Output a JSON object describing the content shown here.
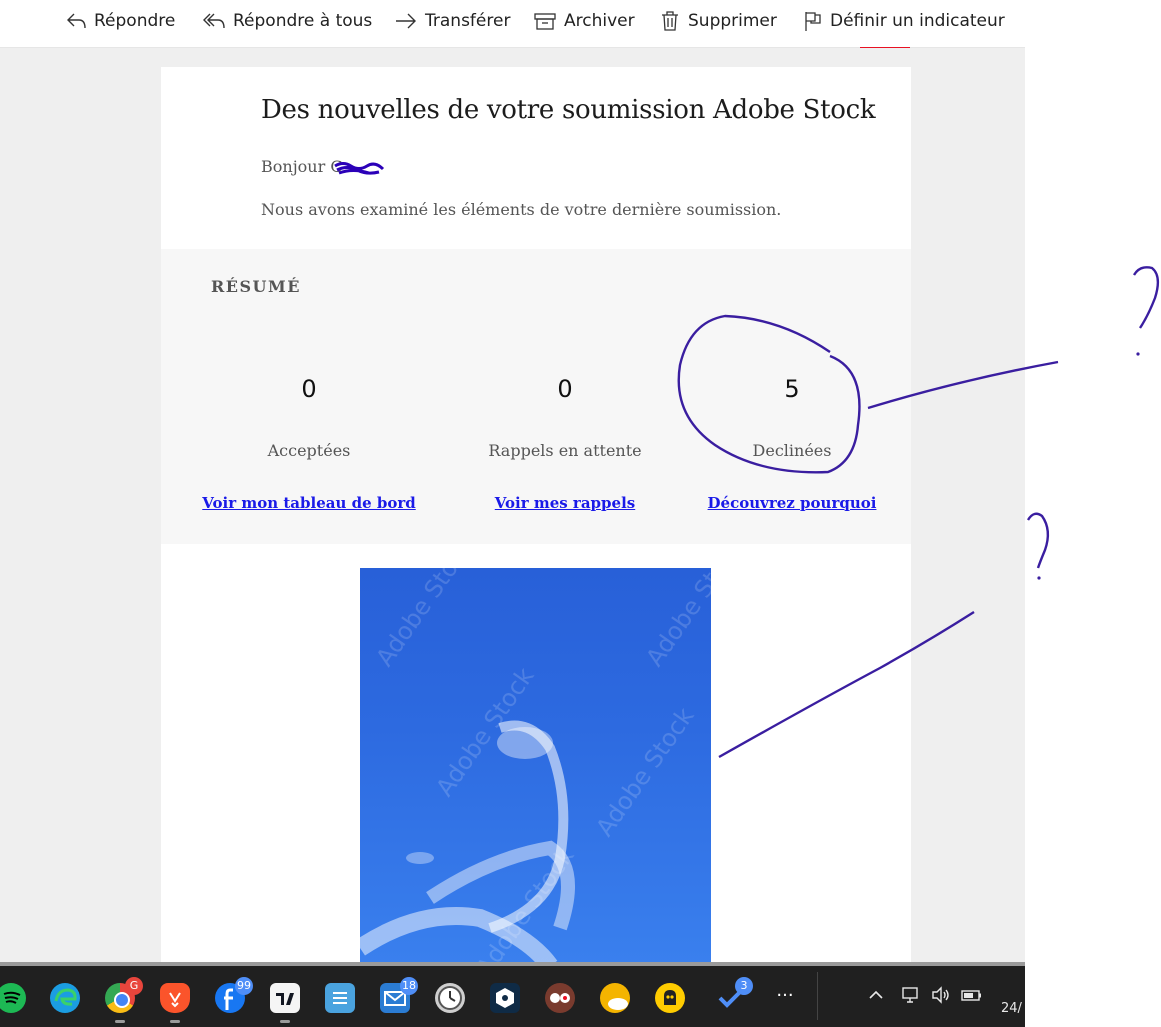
{
  "toolbar": {
    "reply": "Répondre",
    "reply_all": "Répondre à tous",
    "forward": "Transférer",
    "archive": "Archiver",
    "delete": "Supprimer",
    "flag": "Définir un indicateur",
    "accent_color": "#e81123"
  },
  "email": {
    "title": "Des nouvelles de votre soumission Adobe Stock",
    "greeting": "Bonjour C",
    "intro": "Nous avons examiné les éléments de votre dernière soumission.",
    "summary": {
      "heading": "RÉSUMÉ",
      "stats": [
        {
          "value": "0",
          "label": "Acceptées",
          "link": "Voir mon tableau de bord"
        },
        {
          "value": "0",
          "label": "Rappels en attente",
          "link": "Voir mes rappels"
        },
        {
          "value": "5",
          "label": "Declinées",
          "link": "Découvrez pourquoi"
        }
      ]
    },
    "image": {
      "description_icon": "sky-with-clouds-photo",
      "watermark": "Adobe Stock"
    }
  },
  "annotations": {
    "color": "#3a1ea0",
    "question_mark": "?"
  },
  "taskbar": {
    "apps": [
      {
        "name": "spotify-icon",
        "color": "#1db954"
      },
      {
        "name": "edge-icon",
        "color": "#1b9de2"
      },
      {
        "name": "chrome-icon",
        "color": "#e8453c",
        "badge": "G"
      },
      {
        "name": "brave-icon",
        "color": "#fb542b"
      },
      {
        "name": "facebook-icon",
        "color": "#1877f2",
        "badge": "99"
      },
      {
        "name": "tradingview-icon",
        "color": "#131722"
      },
      {
        "name": "notepad-icon",
        "color": "#4aa3df"
      },
      {
        "name": "mail-icon",
        "color": "#2b7cd3",
        "badge": "18"
      },
      {
        "name": "clock-icon",
        "color": "#cfcfcf"
      },
      {
        "name": "deepl-icon",
        "color": "#0f2b46"
      },
      {
        "name": "video-player-icon",
        "color": "#7a3b2e"
      },
      {
        "name": "weather-icon",
        "color": "#f4b400"
      },
      {
        "name": "cyberghost-icon",
        "color": "#ffcc00"
      },
      {
        "name": "todo-icon",
        "color": "#2564cf",
        "badge": "3"
      },
      {
        "name": "more-icon",
        "color": "#202020"
      }
    ],
    "clock_text": "24/"
  }
}
